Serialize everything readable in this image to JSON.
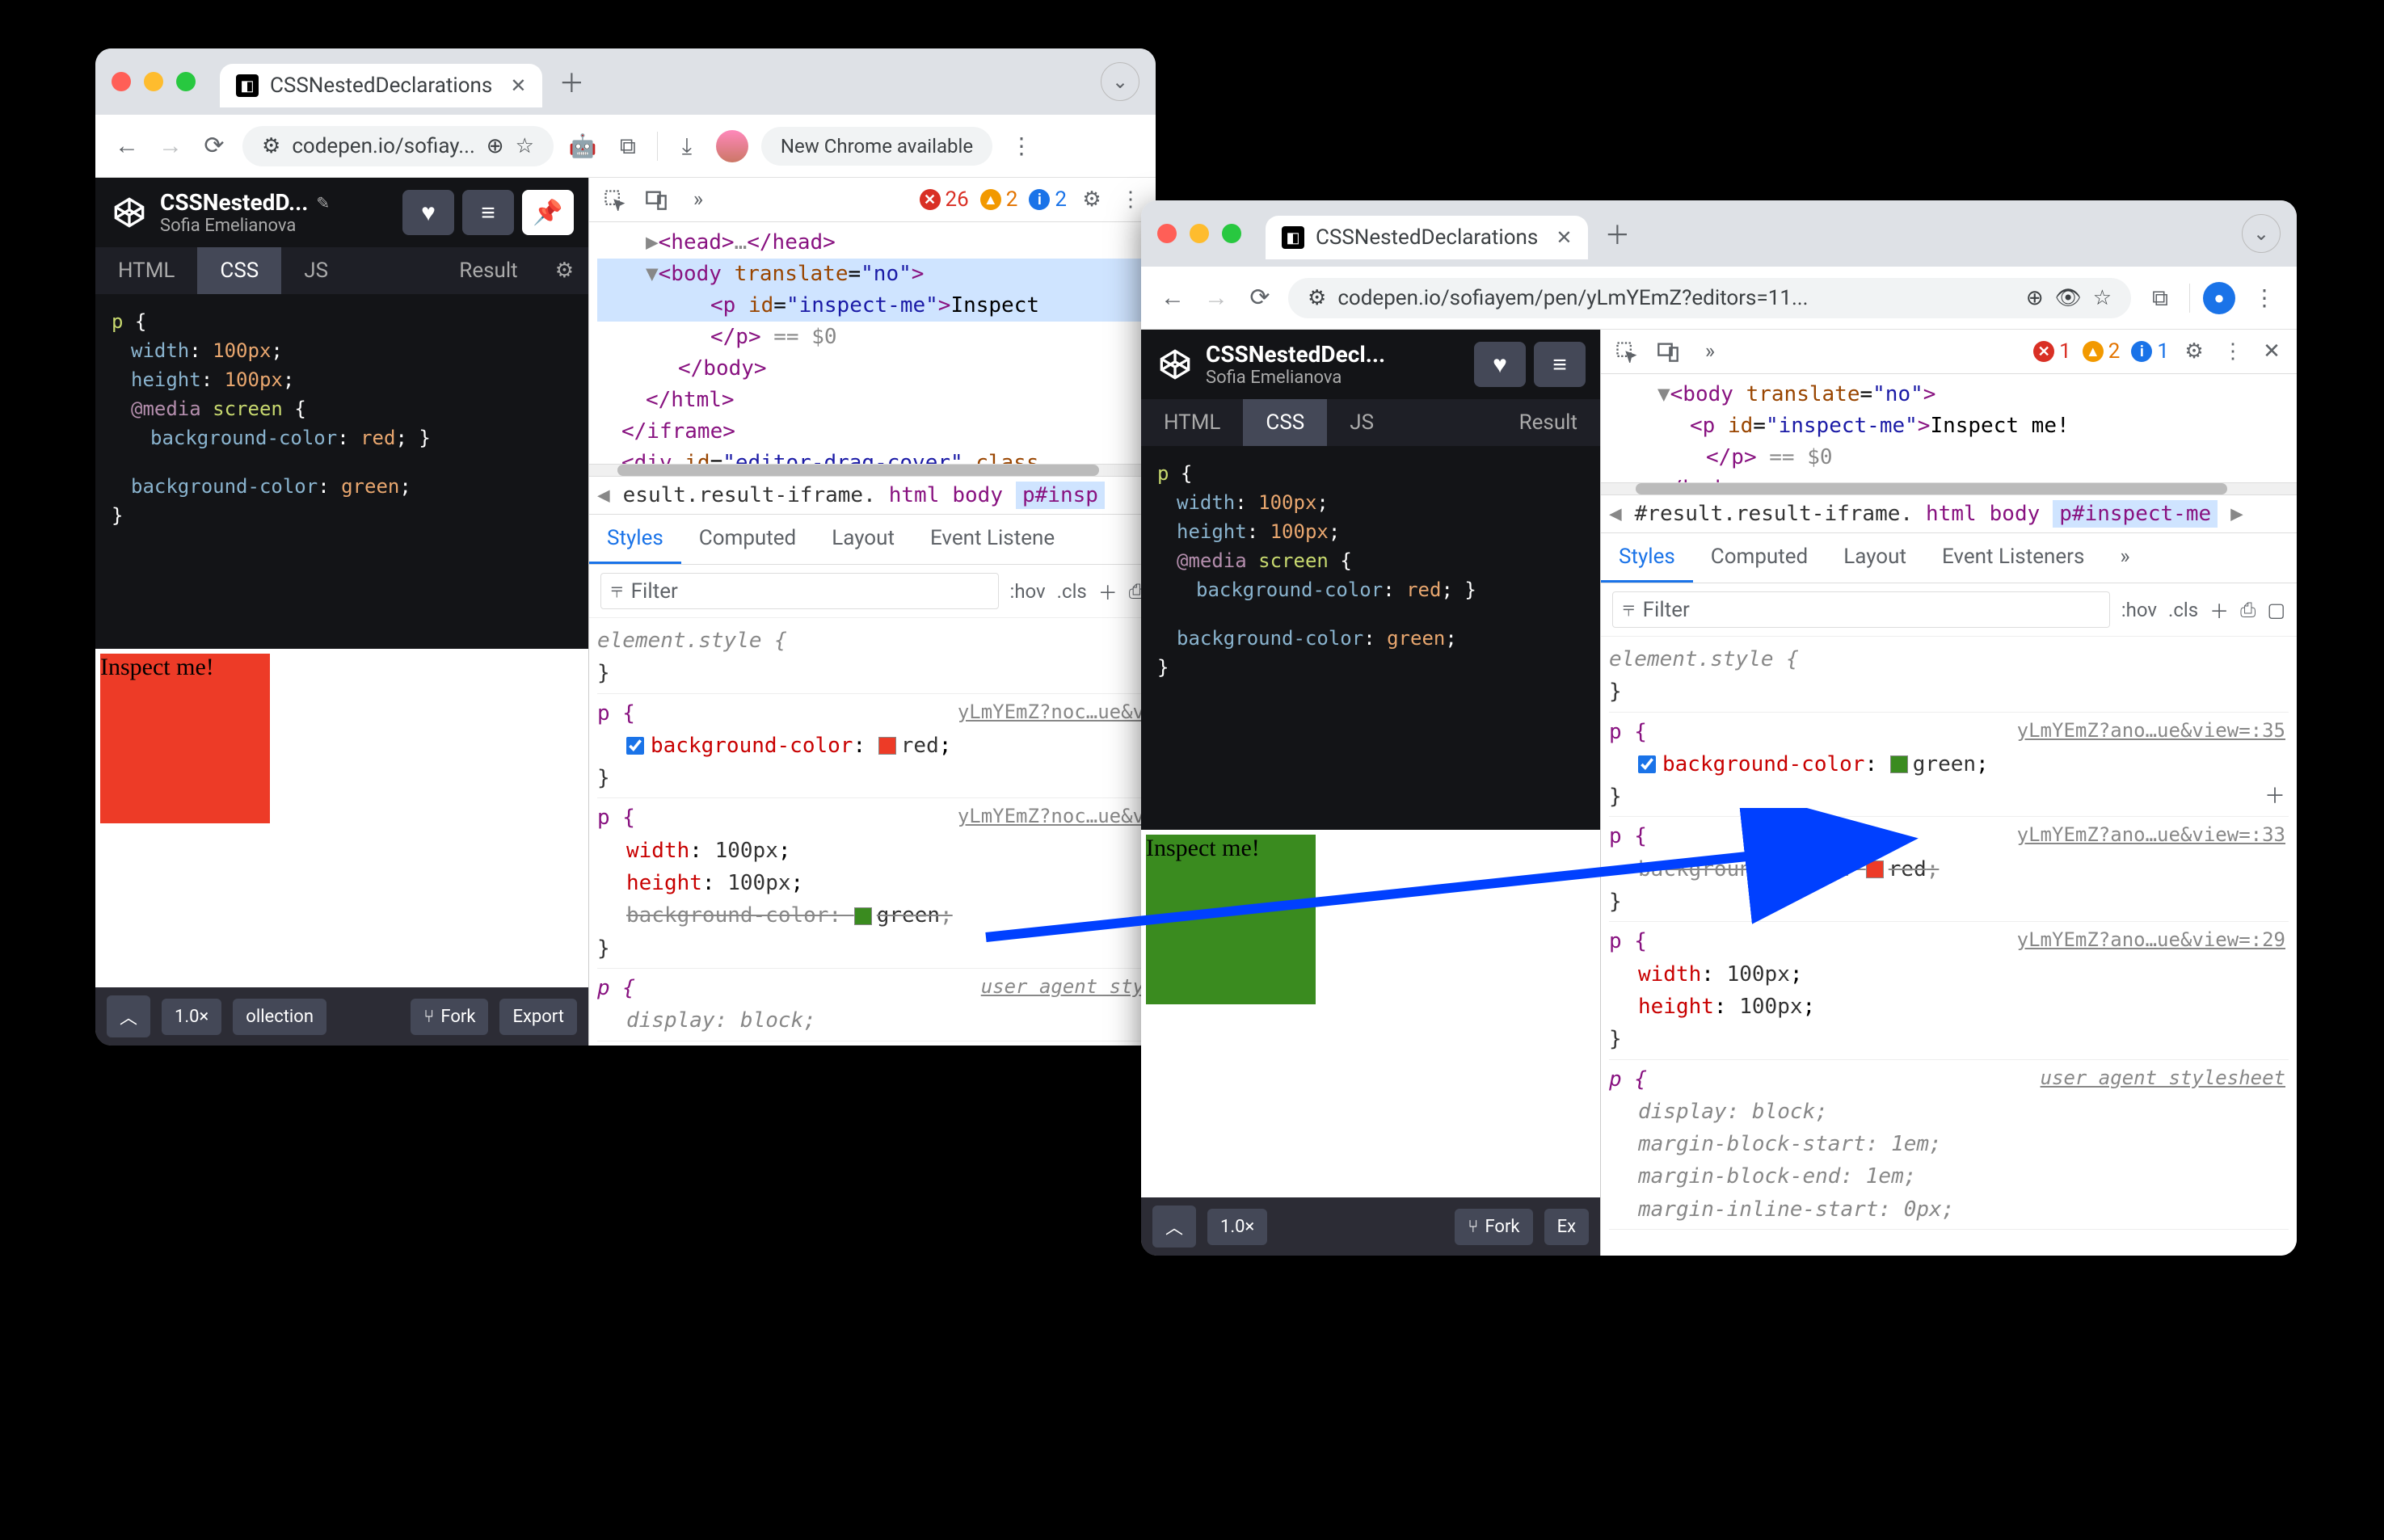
{
  "w1": {
    "tab_title": "CSSNestedDeclarations",
    "url_text": "codepen.io/sofiay...",
    "update_label": "New Chrome available",
    "codepen": {
      "pen_name": "CSSNestedD...",
      "author": "Sofia Emelianova",
      "tabs": {
        "html": "HTML",
        "css": "CSS",
        "js": "JS",
        "result": "Result"
      },
      "css": {
        "l1_sel": "p",
        "l1_br": "{",
        "l2_prop": "width",
        "l2_val": "100px",
        "l3_prop": "height",
        "l3_val": "100px",
        "l4_kw": "@media",
        "l4_arg": "screen",
        "l4_br": "{",
        "l5_prop": "background-color",
        "l5_val": "red",
        "l5_brc": "}",
        "l6_prop": "background-color",
        "l6_val": "green",
        "l7_br": "}"
      },
      "inspect_text": "Inspect me!",
      "footer": {
        "zoom": "1.0×",
        "collection": "ollection",
        "fork": "Fork",
        "export": "Export"
      }
    },
    "devtools": {
      "badges": {
        "errors": "26",
        "warnings": "2",
        "info": "2"
      },
      "elements_html": {
        "head_open": "<head>",
        "head_dots": "…",
        "head_close": "</head>",
        "body_open": "<body",
        "body_attr": "translate",
        "body_val": "\"no\"",
        "body_gt": ">",
        "p_open": "<p",
        "p_attr": "id",
        "p_val": "\"inspect-me\"",
        "p_gt": ">",
        "p_text": "Inspect",
        "p_close": "</p>",
        "p_dim": "== $0",
        "body_close": "</body>",
        "html_close": "</html>",
        "iframe_close": "</iframe>",
        "div_open": "<div",
        "div_attr1": "id",
        "div_val1": "\"editor-drag-cover\"",
        "div_attr2": "class"
      },
      "crumbs": {
        "c1": "esult.result-iframe.",
        "c2": "html",
        "c3": "body",
        "c4": "p#insp"
      },
      "stabs": {
        "styles": "Styles",
        "computed": "Computed",
        "layout": "Layout",
        "listeners": "Event Listene"
      },
      "filter_placeholder": "Filter",
      "hov": ":hov",
      "cls": ".cls",
      "styles": {
        "elem_style": "element.style {",
        "elem_close": "}",
        "b1_sel": "p {",
        "b1_link": "yLmYEmZ?noc…ue&v",
        "b1_prop": "background-color",
        "b1_val": "red",
        "b1_close": "}",
        "b2_sel": "p {",
        "b2_link": "yLmYEmZ?noc…ue&v",
        "b2_p1": "width",
        "b2_v1": "100px",
        "b2_p2": "height",
        "b2_v2": "100px",
        "b2_p3": "background-color",
        "b2_v3": "green",
        "b2_close": "}",
        "b3_sel": "p {",
        "b3_link": "user agent sty",
        "b3_p1": "display",
        "b3_v1": "block"
      }
    }
  },
  "w2": {
    "tab_title": "CSSNestedDeclarations",
    "url_text": "codepen.io/sofiayem/pen/yLmYEmZ?editors=11...",
    "codepen": {
      "pen_name": "CSSNestedDecl...",
      "author": "Sofia Emelianova",
      "tabs": {
        "html": "HTML",
        "css": "CSS",
        "js": "JS",
        "result": "Result"
      },
      "css": {
        "l1_sel": "p",
        "l1_br": "{",
        "l2_prop": "width",
        "l2_val": "100px",
        "l3_prop": "height",
        "l3_val": "100px",
        "l4_kw": "@media",
        "l4_arg": "screen",
        "l4_br": "{",
        "l5_prop": "background-color",
        "l5_val": "red",
        "l5_brc": "}",
        "l6_prop": "background-color",
        "l6_val": "green",
        "l7_br": "}"
      },
      "inspect_text": "Inspect me!",
      "footer": {
        "zoom": "1.0×",
        "fork": "Fork",
        "export": "Ex"
      }
    },
    "devtools": {
      "badges": {
        "errors": "1",
        "warnings": "2",
        "info": "1"
      },
      "elements_html": {
        "body_open": "<body",
        "body_attr": "translate",
        "body_val": "\"no\"",
        "body_gt": ">",
        "p_open": "<p",
        "p_attr": "id",
        "p_val": "\"inspect-me\"",
        "p_gt": ">",
        "p_text": "Inspect me!",
        "p_close": "</p>",
        "p_dim": "== $0",
        "body_close": "</body>"
      },
      "crumbs": {
        "c1": "#result.result-iframe.",
        "c2": "html",
        "c3": "body",
        "c4": "p#inspect-me"
      },
      "stabs": {
        "styles": "Styles",
        "computed": "Computed",
        "layout": "Layout",
        "listeners": "Event Listeners"
      },
      "filter_placeholder": "Filter",
      "hov": ":hov",
      "cls": ".cls",
      "styles": {
        "elem_style": "element.style {",
        "elem_close": "}",
        "b1_sel": "p {",
        "b1_link": "yLmYEmZ?ano…ue&view=:35",
        "b1_prop": "background-color",
        "b1_val": "green",
        "b1_close": "}",
        "b2_sel": "p {",
        "b2_link": "yLmYEmZ?ano…ue&view=:33",
        "b2_p1": "background-color",
        "b2_v1": "red",
        "b2_close": "}",
        "b3_sel": "p {",
        "b3_link": "yLmYEmZ?ano…ue&view=:29",
        "b3_p1": "width",
        "b3_v1": "100px",
        "b3_p2": "height",
        "b3_v2": "100px",
        "b3_close": "}",
        "b4_sel": "p {",
        "b4_link": "user agent stylesheet",
        "b4_p1": "display",
        "b4_v1": "block",
        "b4_p2": "margin-block-start",
        "b4_v2": "1em",
        "b4_p3": "margin-block-end",
        "b4_v3": "1em",
        "b4_p4": "margin-inline-start",
        "b4_v4": "0px"
      }
    }
  }
}
